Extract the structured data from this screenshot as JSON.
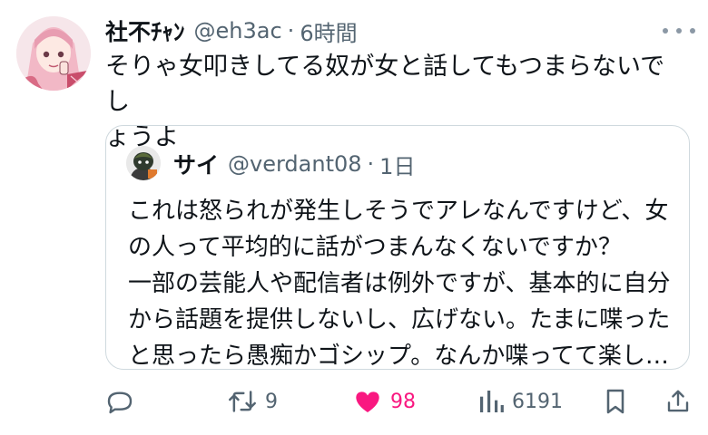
{
  "post": {
    "author_name": "社不ﾁｬﾝ",
    "handle": "@eh3ac",
    "separator": "·",
    "time": "6時間",
    "text": "そりゃ女叩きしてる奴が女と話してもつまらないでし\nょうよ"
  },
  "quote": {
    "author_name": "サイ",
    "handle": "@verdant08",
    "separator": "·",
    "time": "1日",
    "text": "これは怒られが発生しそうでアレなんですけど、女\nの人って平均的に話がつまんなくないですか？\n一部の芸能人や配信者は例外ですが、基本的に自分\nから話題を提供しないし、広げない。たまに喋った\nと思ったら愚痴かゴシップ。なんか喋ってて楽し…"
  },
  "actions": {
    "reply_icon": "speech-bubble-icon",
    "retweet_icon": "retweet-icon",
    "retweet_count": "9",
    "like_icon": "heart-icon",
    "like_count": "98",
    "views_icon": "bar-chart-icon",
    "views_count": "6191",
    "bookmark_icon": "bookmark-icon",
    "share_icon": "share-icon"
  },
  "colors": {
    "text": "#0f1419",
    "secondary": "#536471",
    "like": "#f91880",
    "border": "#cfd9de"
  }
}
